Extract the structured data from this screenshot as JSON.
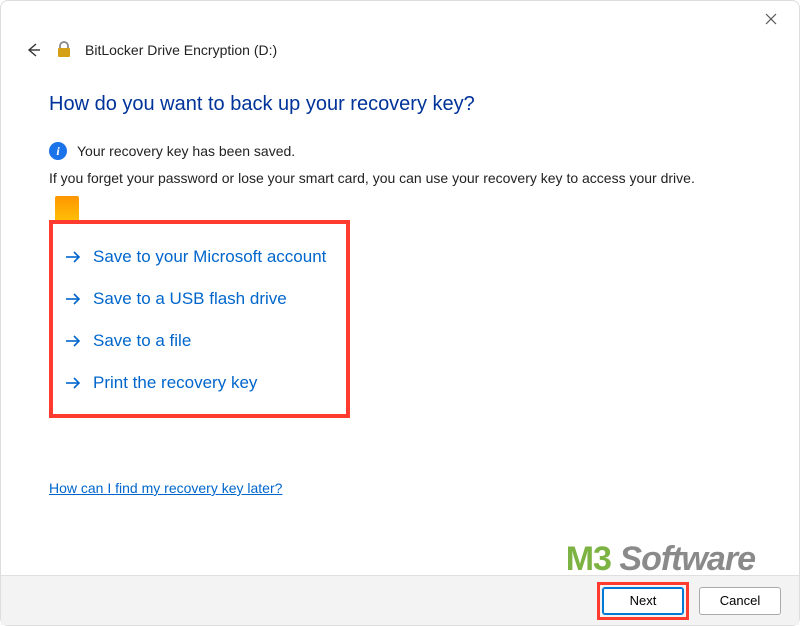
{
  "window": {
    "title": "BitLocker Drive Encryption (D:)"
  },
  "heading": "How do you want to back up your recovery key?",
  "status": "Your recovery key has been saved.",
  "description": "If you forget your password or lose your smart card, you can use your recovery key to access your drive.",
  "options": [
    {
      "label": "Save to your Microsoft account"
    },
    {
      "label": "Save to a USB flash drive"
    },
    {
      "label": "Save to a file"
    },
    {
      "label": "Print the recovery key"
    }
  ],
  "help_link": "How can I find my recovery key later?",
  "footer": {
    "next_label": "Next",
    "cancel_label": "Cancel"
  },
  "watermark": {
    "part1": "M3",
    "part2": " Software"
  }
}
